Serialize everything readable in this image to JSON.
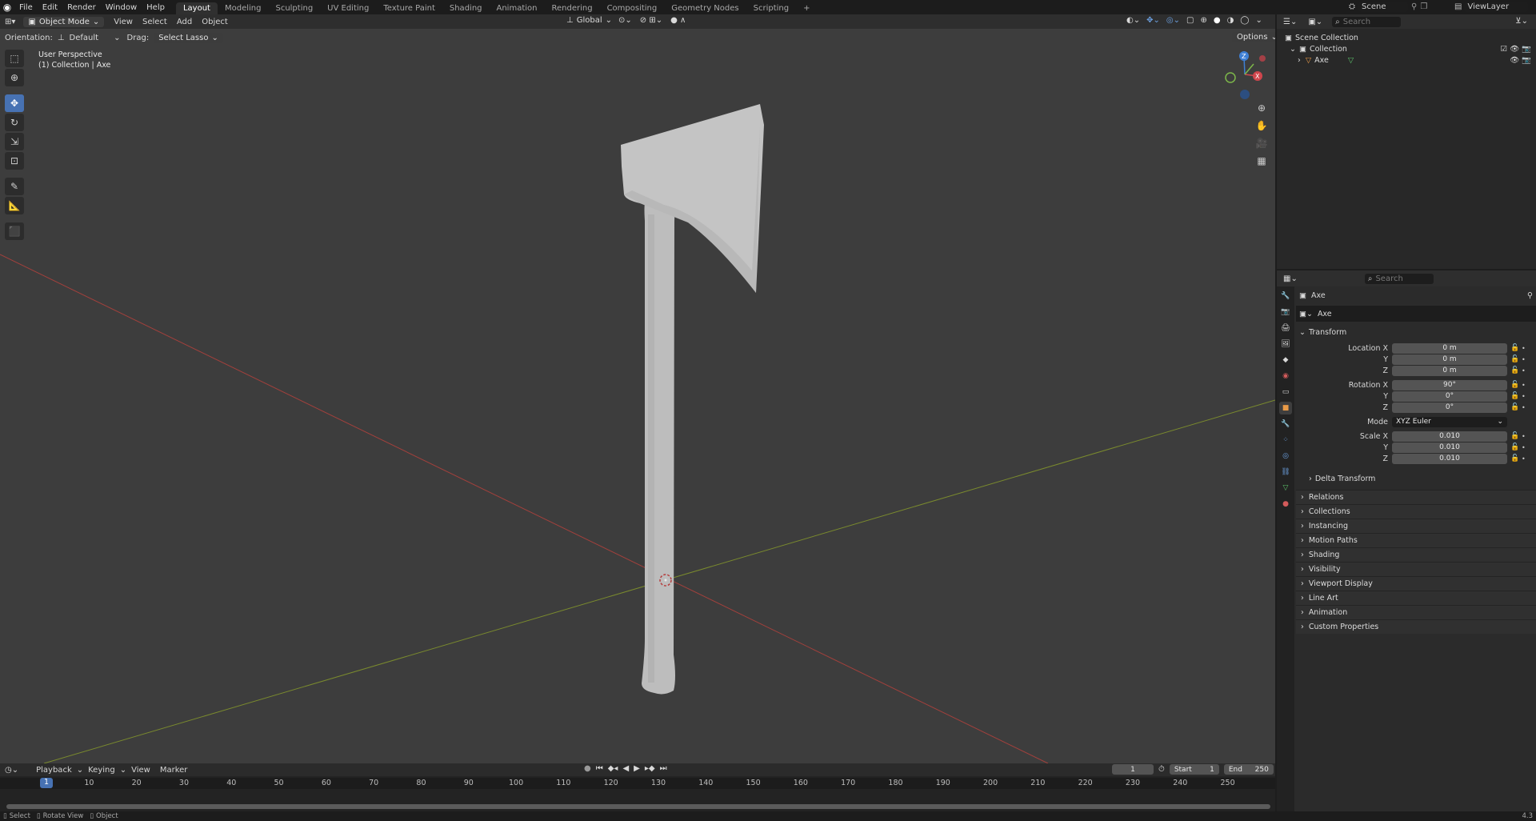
{
  "topbar": {
    "menus": [
      "File",
      "Edit",
      "Render",
      "Window",
      "Help"
    ],
    "workspaces": [
      "Layout",
      "Modeling",
      "Sculpting",
      "UV Editing",
      "Texture Paint",
      "Shading",
      "Animation",
      "Rendering",
      "Compositing",
      "Geometry Nodes",
      "Scripting"
    ],
    "active_workspace": "Layout",
    "add_tab": "+",
    "scene": "Scene",
    "view_layer": "ViewLayer"
  },
  "viewport": {
    "mode": "Object Mode",
    "menus": [
      "View",
      "Select",
      "Add",
      "Object"
    ],
    "transform_orientation": "Global",
    "orientation_label": "Orientation:",
    "orientation_value": "Default",
    "drag_label": "Drag:",
    "drag_value": "Select Lasso",
    "options": "Options",
    "overlay_line1": "User Perspective",
    "overlay_line2": "(1) Collection | Axe",
    "gizmo_axes": {
      "x": "X",
      "y": "Y",
      "z": "Z"
    },
    "colors": {
      "background": "#3d3d3d",
      "x_axis": "#b13d3d",
      "y_axis": "#7f8f2a",
      "axe": "#c9c9c9",
      "accent": "#4772b3"
    }
  },
  "timeline": {
    "menus": [
      "Playback",
      "Keying",
      "View",
      "Marker"
    ],
    "current_frame": "1",
    "start_label": "Start",
    "start_value": "1",
    "end_label": "End",
    "end_value": "250",
    "ruler_ticks": [
      "10",
      "20",
      "30",
      "40",
      "50",
      "60",
      "70",
      "80",
      "90",
      "100",
      "110",
      "120",
      "130",
      "140",
      "150",
      "160",
      "170",
      "180",
      "190",
      "200",
      "210",
      "220",
      "230",
      "240",
      "250"
    ],
    "playhead": "1"
  },
  "statusbar": {
    "items": [
      "Select",
      "Rotate View",
      "Object"
    ],
    "version": "4.3"
  },
  "outliner": {
    "search_placeholder": "Search",
    "rows": [
      "Scene Collection",
      "Collection",
      "Axe"
    ]
  },
  "properties": {
    "search_placeholder": "Search",
    "object_name": "Axe",
    "data_name": "Axe",
    "transform_title": "Transform",
    "location": {
      "label_x": "Location X",
      "label_y": "Y",
      "label_z": "Z",
      "x": "0 m",
      "y": "0 m",
      "z": "0 m"
    },
    "rotation": {
      "label_x": "Rotation X",
      "label_y": "Y",
      "label_z": "Z",
      "x": "90°",
      "y": "0°",
      "z": "0°"
    },
    "mode_label": "Mode",
    "mode_value": "XYZ Euler",
    "scale": {
      "label_x": "Scale X",
      "label_y": "Y",
      "label_z": "Z",
      "x": "0.010",
      "y": "0.010",
      "z": "0.010"
    },
    "delta_transform": "Delta Transform",
    "panels": [
      "Relations",
      "Collections",
      "Instancing",
      "Motion Paths",
      "Shading",
      "Visibility",
      "Viewport Display",
      "Line Art",
      "Animation",
      "Custom Properties"
    ]
  }
}
